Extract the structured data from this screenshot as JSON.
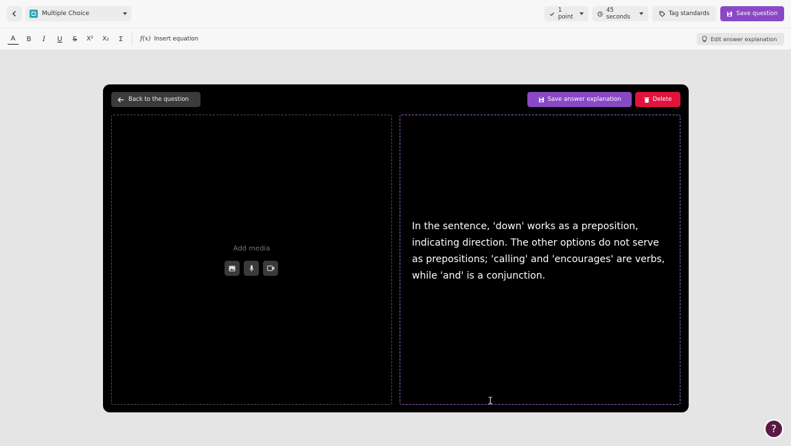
{
  "header": {
    "question_type": "Multiple Choice",
    "points": "1 point",
    "time": "45 seconds",
    "tag_standards": "Tag standards",
    "save_question": "Save question"
  },
  "toolbar": {
    "items": [
      {
        "name": "text-color",
        "glyph": "A"
      },
      {
        "name": "bold",
        "glyph": "B"
      },
      {
        "name": "italic",
        "glyph": "I"
      },
      {
        "name": "underline",
        "glyph": "U"
      },
      {
        "name": "strikethrough",
        "glyph": "S"
      },
      {
        "name": "superscript",
        "glyph": "X²"
      },
      {
        "name": "subscript",
        "glyph": "X₂"
      },
      {
        "name": "sigma",
        "glyph": "Σ"
      }
    ],
    "insert_equation": "Insert equation",
    "edit_answer_explanation": "Edit answer explanation"
  },
  "card": {
    "back_label": "Back to the question",
    "save_explanation_label": "Save answer explanation",
    "delete_label": "Delete",
    "add_media_label": "Add media",
    "explanation_text": "In the sentence, 'down' works as a preposition, indicating direction. The other options do not serve as prepositions; 'calling' and 'encourages' are verbs, while 'and' is a conjunction."
  },
  "help_label": "?",
  "colors": {
    "accent": "#8a48c6",
    "danger": "#e0143c",
    "card_bg": "#000000"
  },
  "icons": [
    "chevron-left-icon",
    "question-type-icon",
    "check-icon",
    "clock-icon",
    "tag-icon",
    "save-icon",
    "function-icon",
    "lightbulb-icon",
    "arrow-left-icon",
    "trash-icon",
    "image-icon",
    "microphone-icon",
    "video-icon",
    "text-cursor-icon",
    "help-icon"
  ]
}
